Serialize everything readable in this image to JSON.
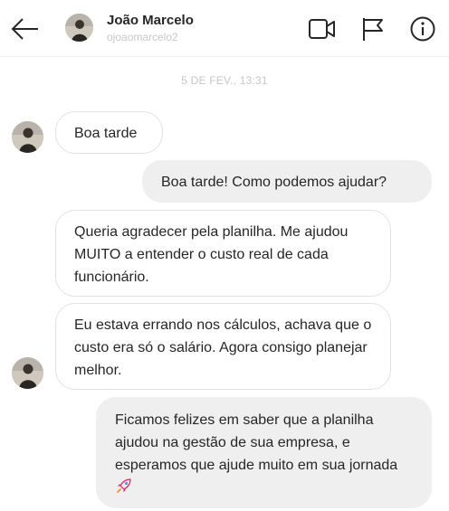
{
  "header": {
    "name": "João Marcelo",
    "username": "ojoaomarcelo2",
    "icons": [
      "back-arrow-icon",
      "video-call-icon",
      "flag-icon",
      "info-icon"
    ]
  },
  "thread": {
    "timestamp": "5 DE FEV., 13:31",
    "messages": [
      {
        "direction": "incoming",
        "text": "Boa tarde"
      },
      {
        "direction": "outgoing",
        "text": "Boa tarde! Como podemos ajudar?"
      },
      {
        "direction": "incoming",
        "text": "Queria agradecer pela planilha. Me ajudou MUITO a entender o custo real de cada funcionário."
      },
      {
        "direction": "incoming",
        "text": "Eu estava errando nos cálculos, achava que o custo era só o salário. Agora consigo planejar melhor."
      },
      {
        "direction": "outgoing",
        "text": "Ficamos felizes em saber que a planilha ajudou na gestão de sua empresa, e esperamos que ajude muito em sua jornada",
        "emoji": "rocket-icon"
      }
    ]
  },
  "colors": {
    "outgoing_bubble": "#efefef",
    "incoming_border": "#e2e2e2",
    "muted_text": "#c7c7c7",
    "text": "#262626"
  }
}
